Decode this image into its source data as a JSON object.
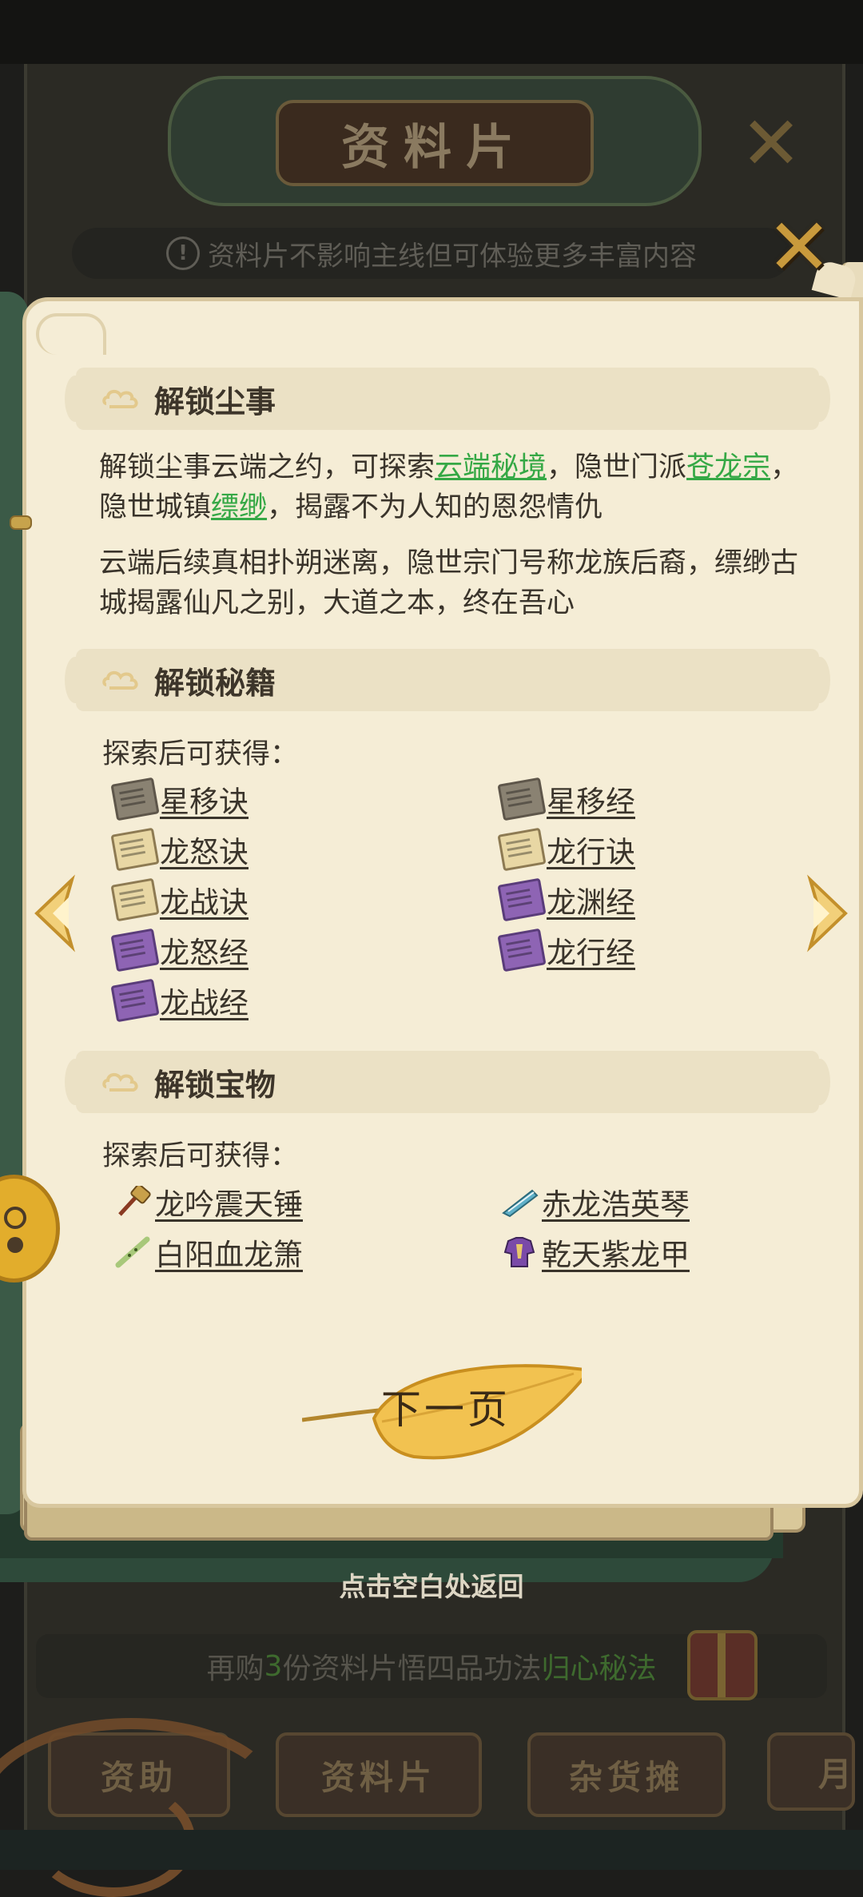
{
  "background": {
    "title": "资料片",
    "notice": "资料片不影响主线但可体验更多丰富内容",
    "notice_icon": "exclamation-circle-icon",
    "promo": {
      "prefix": "再购",
      "count": "3",
      "middle": "份资料片悟四品功法",
      "highlight": "归心秘法"
    },
    "tabs": [
      "资助",
      "资料片",
      "杂货摊",
      "月"
    ]
  },
  "dialog": {
    "close_icon": "close-x-icon",
    "sections": {
      "dust": {
        "title": "解锁尘事",
        "para1": {
          "t1": "解锁尘事云端之约，可探索",
          "link1": "云端秘境",
          "t2": "，隐世门派",
          "link2": "苍龙宗",
          "t3": "，隐世城镇",
          "link3": "缥缈",
          "t4": "，揭露不为人知的恩怨情仇"
        },
        "para2": "云端后续真相扑朔迷离，隐世宗门号称龙族后裔，缥缈古城揭露仙凡之别，大道之本，终在吾心"
      },
      "manuals": {
        "title": "解锁秘籍",
        "subtitle": "探索后可获得：",
        "items": [
          "星移诀",
          "星移经",
          "龙怒诀",
          "龙行诀",
          "龙战诀",
          "龙渊经",
          "龙怒经",
          "龙行经",
          "龙战经"
        ]
      },
      "treasures": {
        "title": "解锁宝物",
        "subtitle": "探索后可获得：",
        "items": [
          "龙吟震天锤",
          "赤龙浩英琴",
          "白阳血龙箫",
          "乾天紫龙甲"
        ]
      }
    },
    "next_button": "下一页",
    "back_hint": "点击空白处返回"
  },
  "colors": {
    "link_green": "#35a845",
    "page_bg": "#f5edd6",
    "gold": "#c99a3c"
  }
}
